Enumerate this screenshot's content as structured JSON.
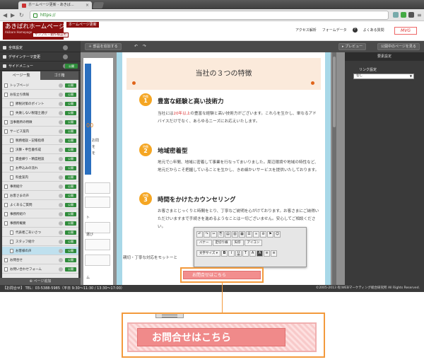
{
  "browser": {
    "tab_title": "ホームページ更新 - あきば…",
    "url": "https://"
  },
  "header": {
    "logo_line1": "あきばれホームページ",
    "logo_line2": "Akibare Homepage",
    "tag_hp": "ホームページ更新",
    "tag_sample": "サンプル・動作検証用",
    "links": [
      "アクセス解析",
      "フォームデータ",
      "よくある質問"
    ],
    "brand": "MVG"
  },
  "sidebar": {
    "sections": [
      {
        "label": "全体設定"
      },
      {
        "label": "デザインテーマ変更"
      },
      {
        "label": "サイドメニュー",
        "badge": "公開"
      }
    ],
    "tabs": [
      "ページ一覧",
      "ゴミ箱"
    ],
    "pages": [
      {
        "label": "トップページ",
        "indent": 0
      },
      {
        "label": "お役立ち情報",
        "indent": 0
      },
      {
        "label": "節税対策のポイント",
        "indent": 1
      },
      {
        "label": "失敗しない税理士選び",
        "indent": 1
      },
      {
        "label": "当事務所の特徴",
        "indent": 0
      },
      {
        "label": "サービス案内",
        "indent": 0
      },
      {
        "label": "税務相談・記帳指導",
        "indent": 1
      },
      {
        "label": "決算・申告書作成",
        "indent": 1
      },
      {
        "label": "資金繰り・精度相談",
        "indent": 1
      },
      {
        "label": "お申込みの流れ",
        "indent": 1
      },
      {
        "label": "料金案内",
        "indent": 1
      },
      {
        "label": "事例紹介",
        "indent": 0
      },
      {
        "label": "お客さまの声",
        "indent": 0
      },
      {
        "label": "よくあるご質問",
        "indent": 0
      },
      {
        "label": "事務所紹介",
        "indent": 0
      },
      {
        "label": "事務所概要",
        "indent": 0
      },
      {
        "label": "代表者ごあいさつ",
        "indent": 1
      },
      {
        "label": "スタッフ紹介",
        "indent": 1
      },
      {
        "label": "お客様の声",
        "indent": 1
      },
      {
        "label": "お問合せ",
        "indent": 0
      },
      {
        "label": "お問い合わせフォーム",
        "indent": 0
      }
    ],
    "pub_label": "公開",
    "add_page": "ページ追加"
  },
  "edit_toolbar": {
    "add_part": "部品を追加する",
    "undo": "↶",
    "redo": "↷",
    "preview": "プレビュー",
    "publish": "公開中のページを見る"
  },
  "content": {
    "section_title": "当社の３つの特徴",
    "features": [
      {
        "num_label": "特徴",
        "num": "1",
        "heading": "豊富な経験と高い技術力",
        "body_pre": "当社には",
        "body_red": "20年以上",
        "body_post": "の豊富な経験と高い技術力がございます。これらを生かし、単なるアドバイスだけでなく、あらゆるニーズにお応えいたします。"
      },
      {
        "num_label": "特徴",
        "num": "2",
        "heading": "地域密着型",
        "body": "地元で○年間、地域に密着して事業を行なってまいりました。周辺環境や地域の特性など、地元だからこそ把握していることを生かし、きめ細かいサービスを提供いたしております。"
      },
      {
        "num_label": "特徴",
        "num": "3",
        "heading": "時間をかけたカウンセリング",
        "body": "お客さまとじっくりと時間をとり、丁寧なご説明を心がけております。お客さまにご納得いただけいますまで手続きを進めるようなことは一切ございません。安心してご相談ください。"
      }
    ],
    "lead_text": "親切・丁寧な対応をモットーと",
    "left_strip": {
      "orange": "00",
      "lines": [
        "お問",
        "を",
        "を"
      ],
      "bottom_lines": [
        "ト",
        "選び",
        "ム"
      ]
    }
  },
  "right_panel": {
    "title": "要素設定",
    "link_label": "リンク設定",
    "select_value": "なし"
  },
  "popup": {
    "row2": [
      "バナー",
      "定切り線",
      "矢印",
      "アイコン"
    ],
    "row3_select": "文字サイズ",
    "row3_icons": [
      "B",
      "I",
      "U",
      "T",
      "A",
      "A"
    ]
  },
  "contact_button": "お問合せはこちら",
  "footer": {
    "left": "【お問合せ】 TEL：03-5388-5985（平日 9:30〜11:30 / 13:30〜17:00）",
    "right": "©2005-2013 有)WEBマーケティング総合研究所 All Rights Reserved."
  }
}
